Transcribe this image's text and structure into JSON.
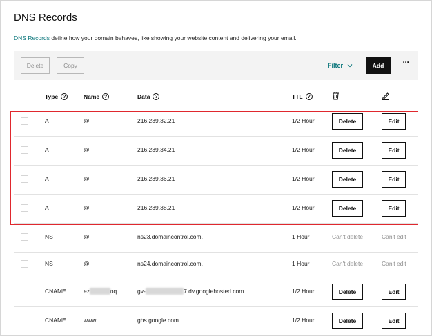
{
  "page": {
    "title": "DNS Records"
  },
  "description": {
    "link": "DNS Records",
    "text": " define how your domain behaves, like showing your website content and delivering your email."
  },
  "toolbar": {
    "delete_label": "Delete",
    "copy_label": "Copy",
    "filter_label": "Filter",
    "add_label": "Add",
    "more_label": "···"
  },
  "columns": {
    "type": "Type",
    "name": "Name",
    "data": "Data",
    "ttl": "TTL"
  },
  "records": [
    {
      "type": "A",
      "name": "@",
      "data": "216.239.32.21",
      "ttl": "1/2 Hour",
      "delete": "Delete",
      "edit": "Edit"
    },
    {
      "type": "A",
      "name": "@",
      "data": "216.239.34.21",
      "ttl": "1/2 Hour",
      "delete": "Delete",
      "edit": "Edit"
    },
    {
      "type": "A",
      "name": "@",
      "data": "216.239.36.21",
      "ttl": "1/2 Hour",
      "delete": "Delete",
      "edit": "Edit"
    },
    {
      "type": "A",
      "name": "@",
      "data": "216.239.38.21",
      "ttl": "1/2 Hour",
      "delete": "Delete",
      "edit": "Edit"
    },
    {
      "type": "NS",
      "name": "@",
      "data": "ns23.domaincontrol.com.",
      "ttl": "1 Hour",
      "delete": "Can't delete",
      "edit": "Can't edit"
    },
    {
      "type": "NS",
      "name": "@",
      "data": "ns24.domaincontrol.com.",
      "ttl": "1 Hour",
      "delete": "Can't delete",
      "edit": "Can't edit"
    },
    {
      "type": "CNAME",
      "name_prefix": "ez",
      "name_suffix": "oq",
      "data_prefix": "gv-",
      "data_suffix": "7.dv.googlehosted.com.",
      "ttl": "1/2 Hour",
      "delete": "Delete",
      "edit": "Edit"
    },
    {
      "type": "CNAME",
      "name": "www",
      "data": "ghs.google.com.",
      "ttl": "1/2 Hour",
      "delete": "Delete",
      "edit": "Edit"
    }
  ],
  "colors": {
    "accent": "#09757a",
    "highlight": "#e0282e",
    "primary": "#111111"
  },
  "icons": {
    "help": "help-circle-icon",
    "trash": "trash-icon",
    "edit": "pencil-icon",
    "filter": "chevron-down-icon"
  }
}
